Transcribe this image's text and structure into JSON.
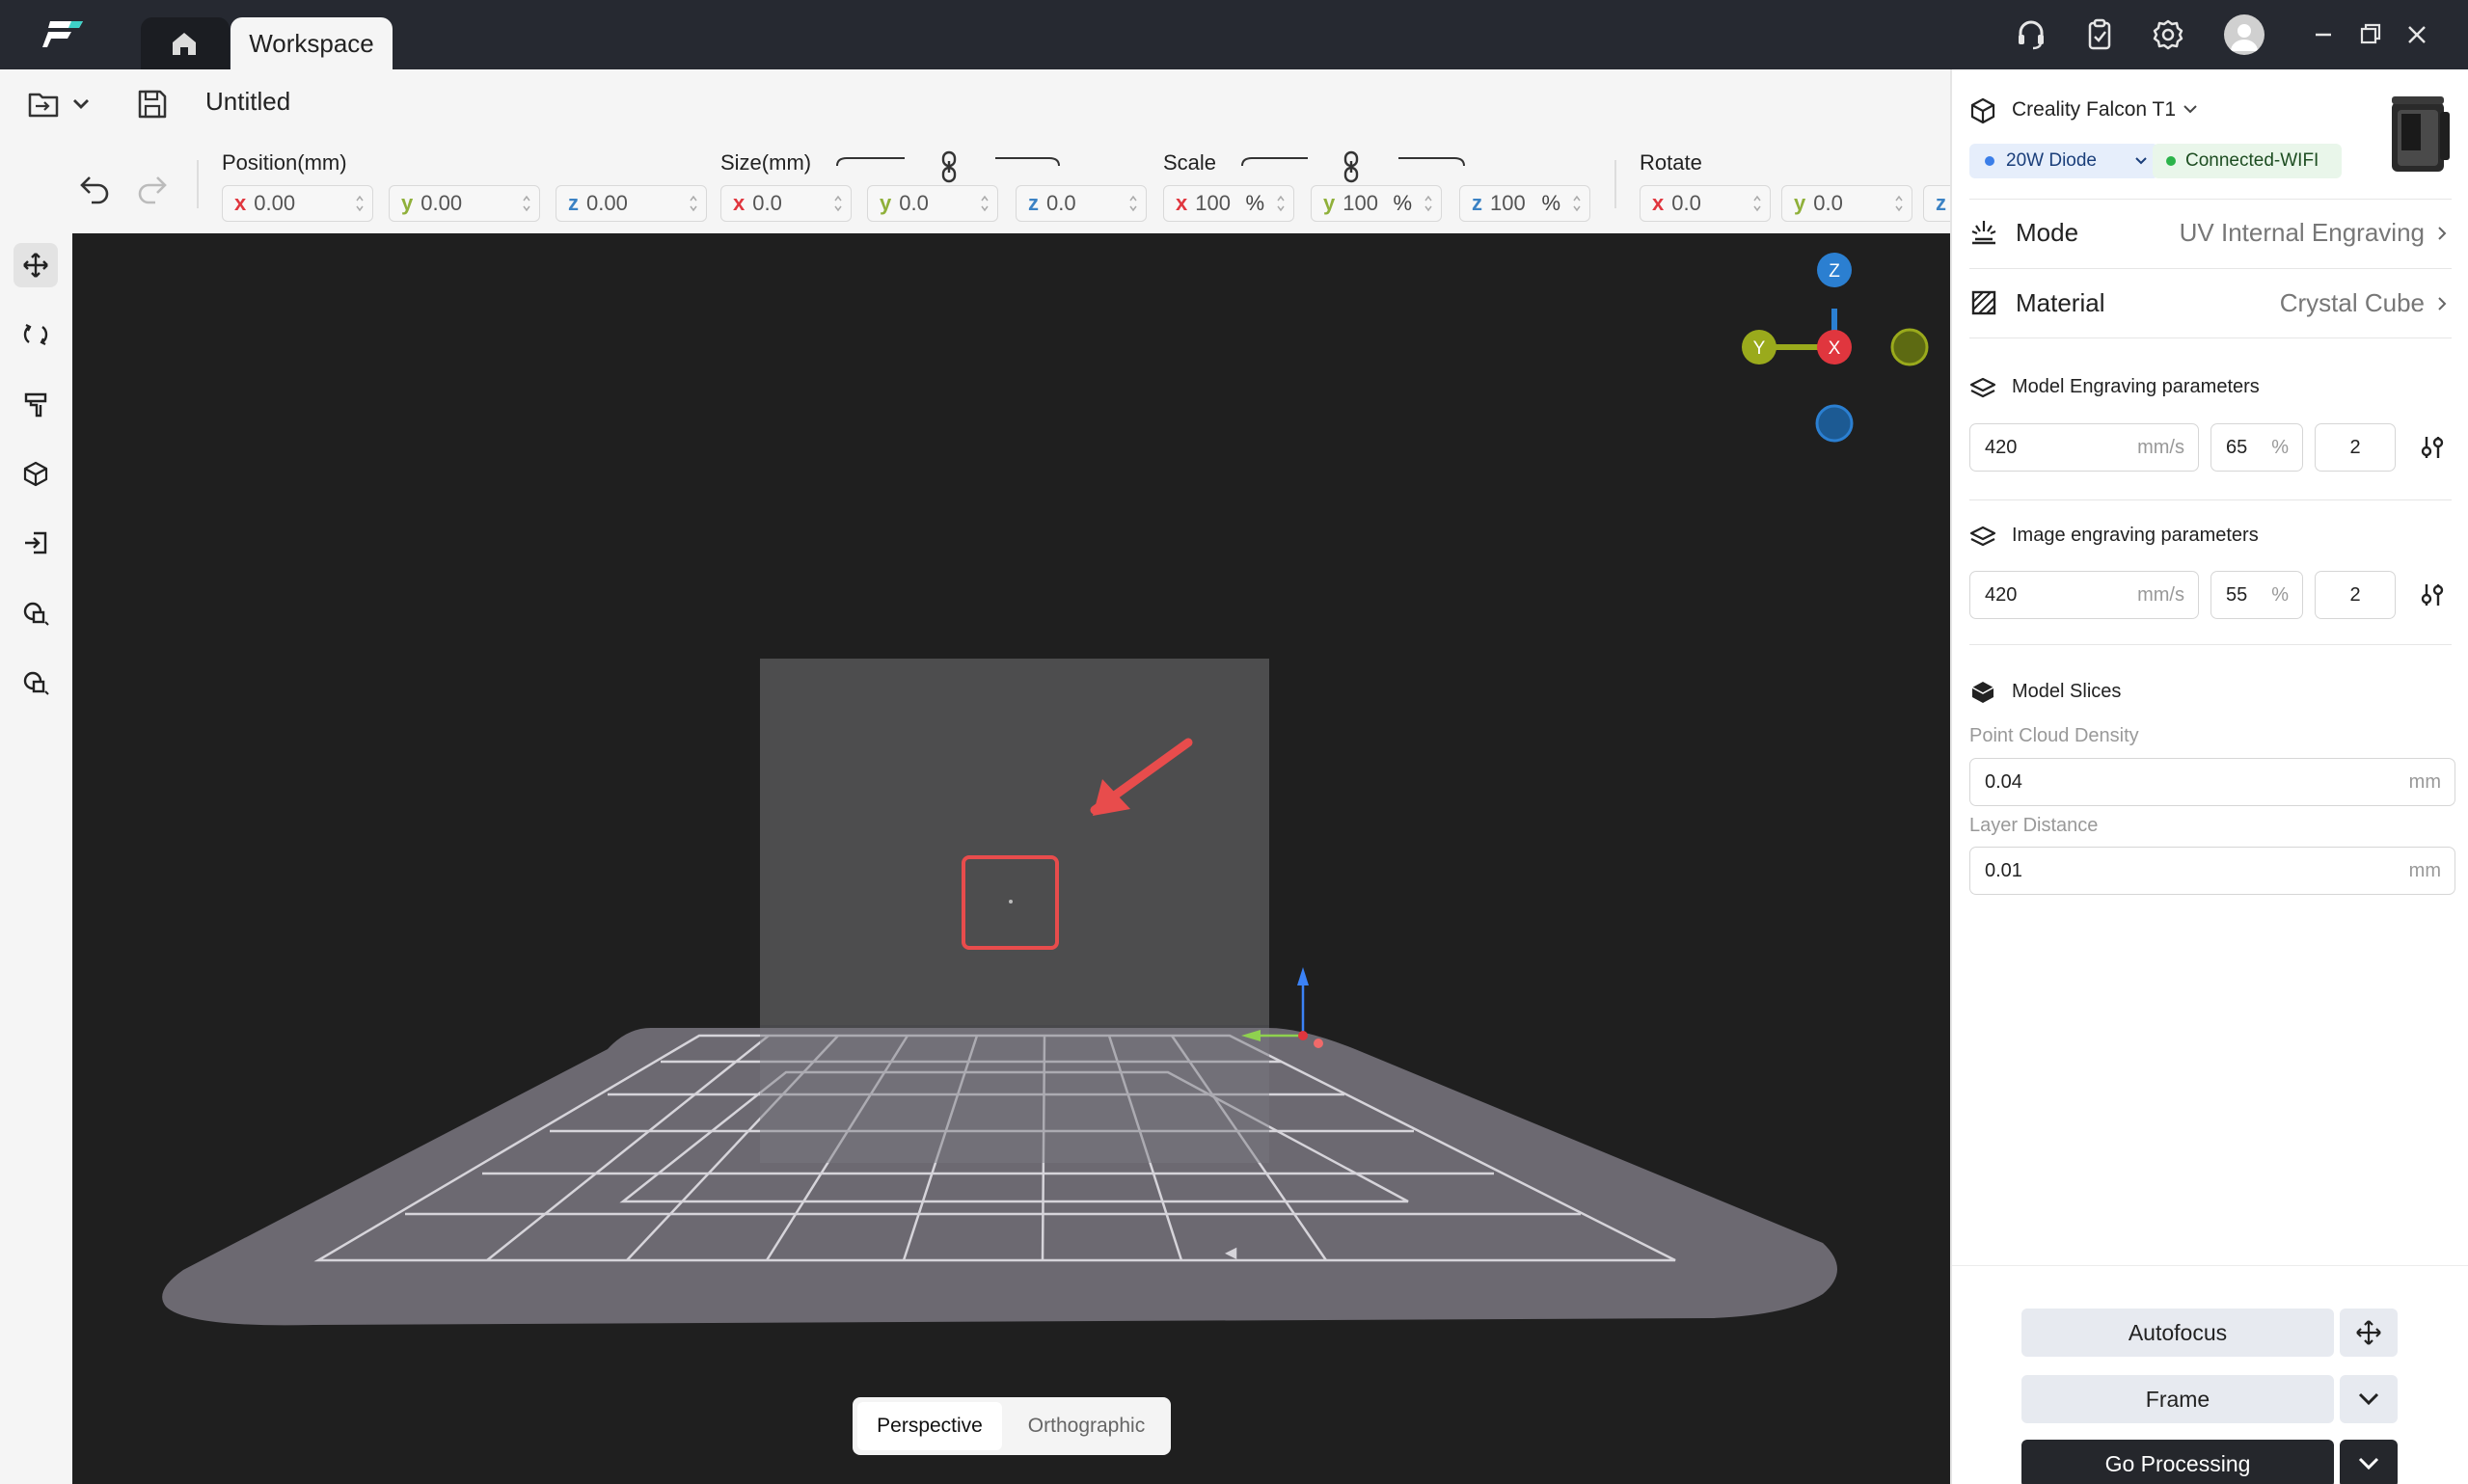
{
  "titlebar": {
    "tab_workspace": "Workspace",
    "icons": [
      "app-logo",
      "home-icon",
      "headset-icon",
      "clipboard-icon",
      "gear-icon",
      "avatar",
      "minimize-icon",
      "restore-icon",
      "close-icon"
    ]
  },
  "menu": {
    "file_title": "Untitled"
  },
  "toolbar": {
    "position": {
      "label": "Position(mm)",
      "x": "0.00",
      "y": "0.00",
      "z": "0.00"
    },
    "size": {
      "label": "Size(mm)",
      "x": "0.0",
      "y": "0.0",
      "z": "0.0"
    },
    "scale": {
      "label": "Scale",
      "x": "100",
      "y": "100",
      "z": "100",
      "unit": "%"
    },
    "rotate": {
      "label": "Rotate",
      "x": "0.0",
      "y": "0.0",
      "z_axis": "z"
    },
    "axis_labels": {
      "x": "x",
      "y": "y",
      "z": "z"
    }
  },
  "viewport": {
    "gizmo": {
      "z": "Z",
      "y": "Y",
      "x": "X"
    },
    "view_modes": {
      "perspective": "Perspective",
      "orthographic": "Orthographic",
      "active": "Perspective"
    }
  },
  "panel": {
    "machine": "Creality Falcon T1",
    "laser": "20W Diode",
    "connection": "Connected-WIFI",
    "mode": {
      "label": "Mode",
      "value": "UV Internal Engraving"
    },
    "material": {
      "label": "Material",
      "value": "Crystal Cube"
    },
    "model_params": {
      "title": "Model Engraving parameters",
      "speed": "420",
      "speed_unit": "mm/s",
      "power": "65",
      "power_unit": "%",
      "passes": "2"
    },
    "image_params": {
      "title": "Image engraving parameters",
      "speed": "420",
      "speed_unit": "mm/s",
      "power": "55",
      "power_unit": "%",
      "passes": "2"
    },
    "slices": {
      "title": "Model Slices",
      "density_label": "Point Cloud Density",
      "density": "0.04",
      "density_unit": "mm",
      "layer_label": "Layer Distance",
      "layer": "0.01",
      "layer_unit": "mm"
    },
    "actions": {
      "autofocus": "Autofocus",
      "frame": "Frame",
      "go": "Go Processing"
    }
  },
  "colors": {
    "accent_dark": "#25272c",
    "axis_x": "#e0363e",
    "axis_y": "#8fb03a",
    "axis_z": "#3b82c4",
    "highlight": "#e84c4c"
  }
}
